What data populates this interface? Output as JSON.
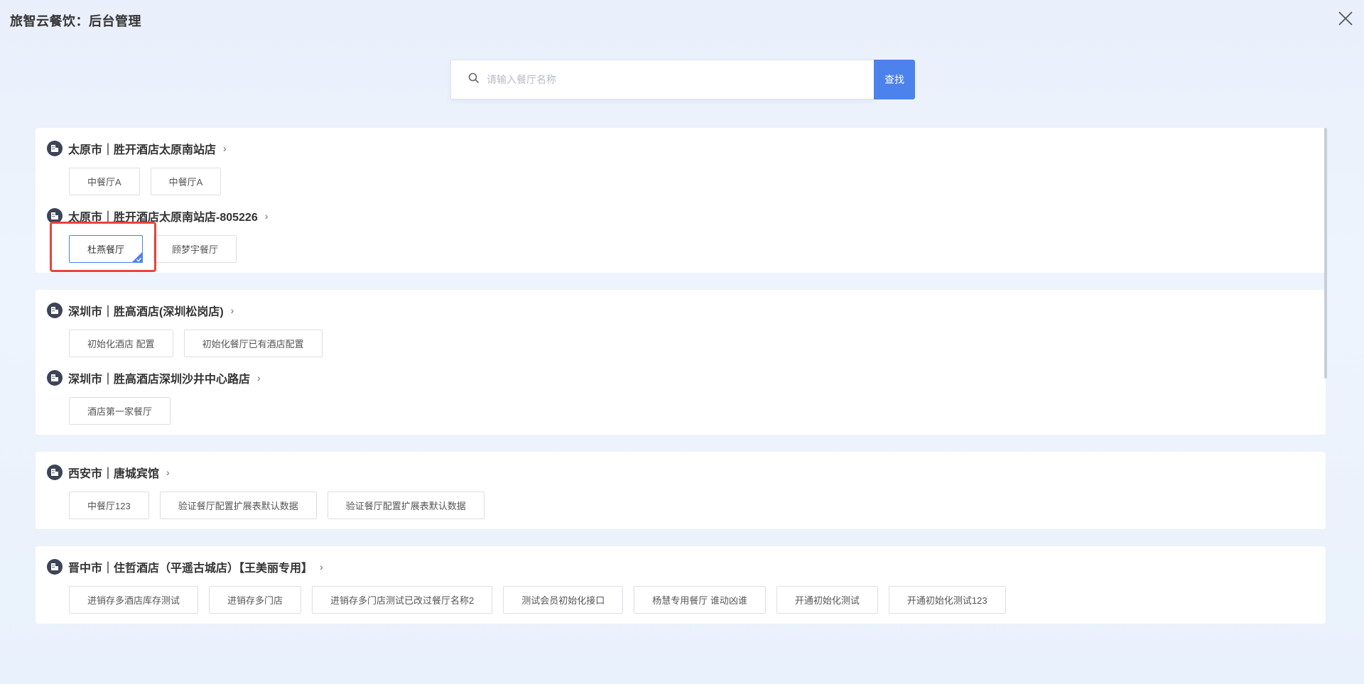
{
  "app_title": "旅智云餐饮：后台管理",
  "search": {
    "placeholder": "请输入餐厅名称",
    "button_label": "查找"
  },
  "groups": [
    {
      "hotels": [
        {
          "name": "太原市｜胜开酒店太原南站店",
          "restaurants": [
            "中餐厅A",
            "中餐厅A"
          ]
        },
        {
          "name": "太原市｜胜开酒店太原南站店-805226",
          "restaurants": [
            "杜燕餐厅",
            "顾梦宇餐厅"
          ],
          "selected_index": 0
        }
      ]
    },
    {
      "hotels": [
        {
          "name": "深圳市｜胜高酒店(深圳松岗店)",
          "restaurants": [
            "初始化酒店 配置",
            "初始化餐厅已有酒店配置"
          ]
        },
        {
          "name": "深圳市｜胜高酒店深圳沙井中心路店",
          "restaurants": [
            "酒店第一家餐厅"
          ]
        }
      ]
    },
    {
      "hotels": [
        {
          "name": "西安市｜唐城宾馆",
          "restaurants": [
            "中餐厅123",
            "验证餐厅配置扩展表默认数据",
            "验证餐厅配置扩展表默认数据"
          ]
        }
      ]
    },
    {
      "hotels": [
        {
          "name": "晋中市｜住哲酒店（平遥古城店）【王美丽专用】",
          "restaurants": [
            "进销存多酒店库存测试",
            "进销存多门店",
            "进销存多门店测试已改过餐厅名称2",
            "测试会员初始化接口",
            "杨慧专用餐厅 谁动凶谁",
            "开通初始化测试",
            "开通初始化测试123"
          ]
        }
      ]
    }
  ],
  "colors": {
    "accent": "#4c82ec",
    "highlight": "#e8433c",
    "hotel_icon": "#3d4456"
  },
  "icons": {
    "close": "close-icon",
    "search": "search-icon",
    "hotel": "building-icon",
    "chevron": "chevron-right-icon",
    "check": "check-badge-icon"
  }
}
